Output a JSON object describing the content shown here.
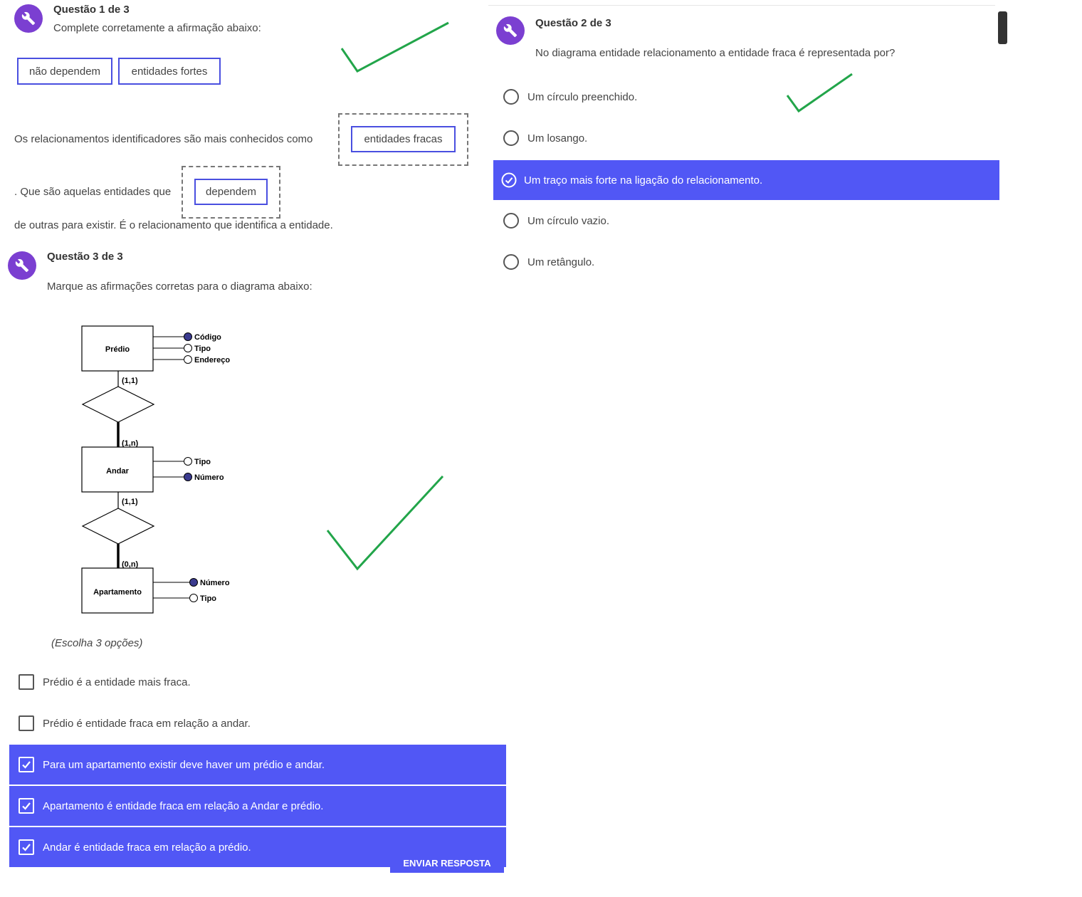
{
  "q1": {
    "title": "Questão 1 de 3",
    "prompt": "Complete corretamente a afirmação abaixo:",
    "chips": [
      "não dependem",
      "entidades fortes"
    ],
    "sentence_part1": "Os relacionamentos identificadores são mais conhecidos como",
    "blank1_answer": "entidades fracas",
    "sentence_part2": ". Que são aquelas entidades que",
    "blank2_answer": "dependem",
    "sentence_part3": "de outras para existir. É o relacionamento que identifica a entidade."
  },
  "q2": {
    "title": "Questão 2 de 3",
    "prompt": "No diagrama entidade relacionamento a entidade fraca é representada por?",
    "options": [
      "Um círculo preenchido.",
      "Um losango.",
      "Um traço mais forte na ligação do relacionamento.",
      "Um círculo vazio.",
      "Um retângulo."
    ],
    "selected_index": 2
  },
  "q3": {
    "title": "Questão 3 de 3",
    "prompt": "Marque as afirmações corretas para o diagrama abaixo:",
    "hint": "(Escolha 3 opções)",
    "options": [
      "Prédio é a entidade mais fraca.",
      "Prédio é entidade fraca em relação a andar.",
      "Para um apartamento existir deve haver um prédio e andar.",
      "Apartamento é entidade fraca em relação a Andar e prédio.",
      "Andar é entidade fraca em relação a prédio."
    ],
    "selected": [
      false,
      false,
      true,
      true,
      true
    ],
    "submit_label": "ENVIAR RESPOSTA"
  },
  "diagram": {
    "entities": [
      "Prédio",
      "Andar",
      "Apartamento"
    ],
    "predio_attrs": [
      "Código",
      "Tipo",
      "Endereço"
    ],
    "andar_attrs": [
      "Tipo",
      "Número"
    ],
    "apto_attrs": [
      "Número",
      "Tipo"
    ],
    "card_predio": "(1,1)",
    "card_andar_top": "(1,n)",
    "card_andar_bottom": "(1,1)",
    "card_apto": "(0,n)"
  },
  "colors": {
    "accent": "#5157f5",
    "icon_bg": "#7b3fd1",
    "check_mark": "#22a54a",
    "chip_border": "#4a4fe0"
  }
}
